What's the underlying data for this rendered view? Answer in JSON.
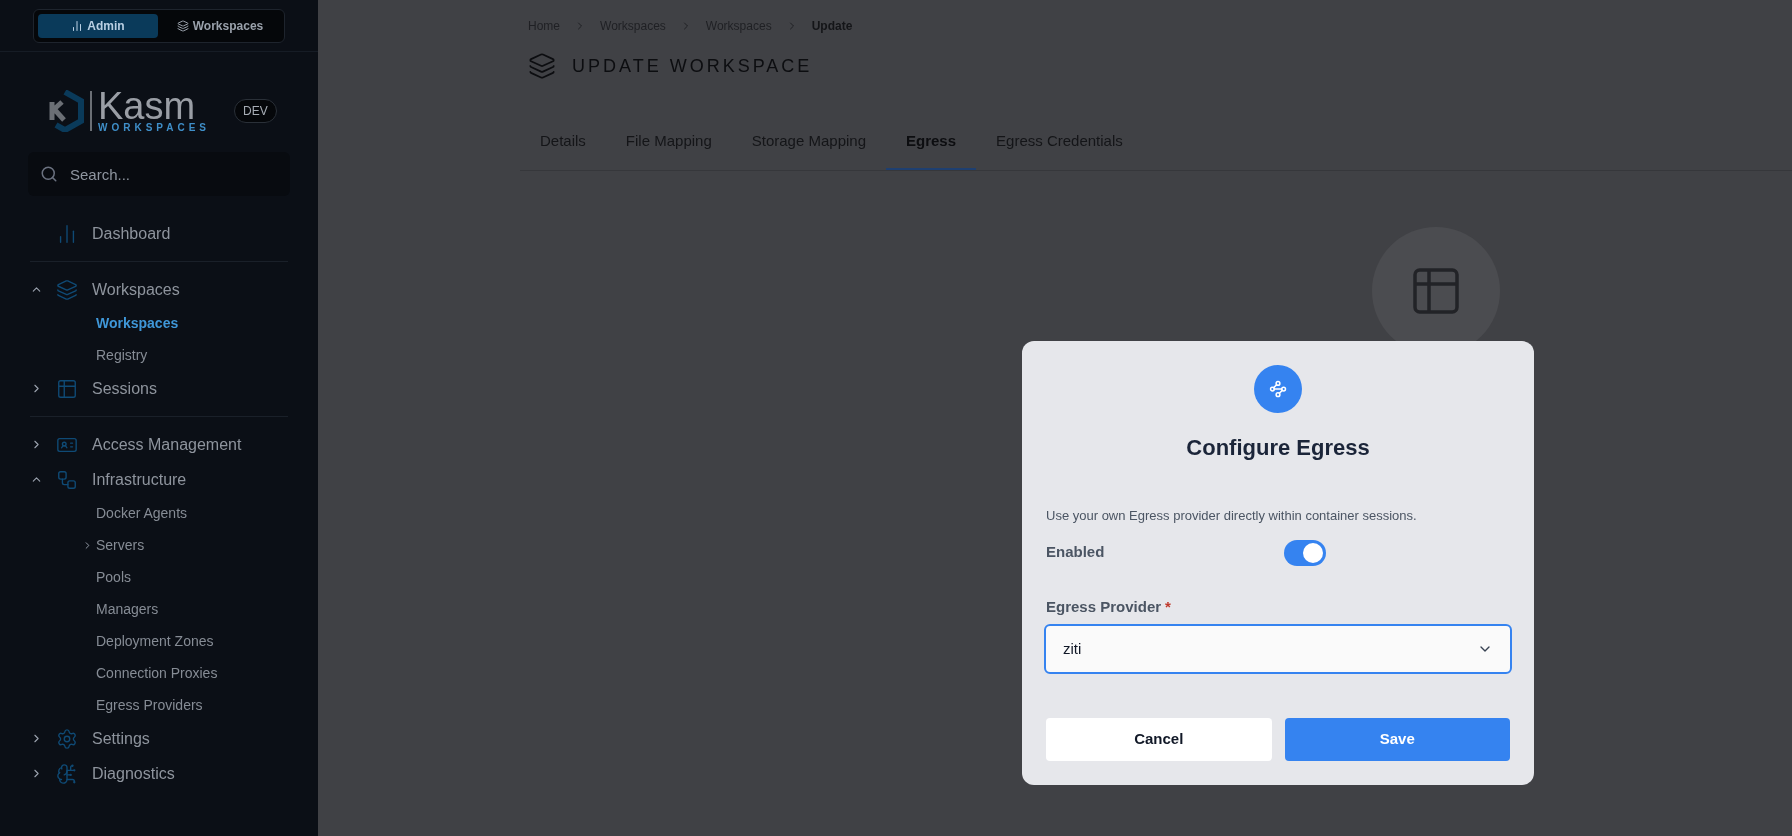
{
  "top_switch": [
    {
      "label": "Admin",
      "selected": true
    },
    {
      "label": "Workspaces",
      "selected": false
    }
  ],
  "logo": {
    "name": "Kasm",
    "tagline": "WORKSPACES"
  },
  "env_badge": "DEV",
  "search": {
    "placeholder": "Search..."
  },
  "nav": [
    {
      "label": "Dashboard"
    },
    {
      "label": "Workspaces",
      "expanded": true,
      "children": [
        {
          "label": "Workspaces",
          "selected": true
        },
        {
          "label": "Registry",
          "selected": false
        }
      ]
    },
    {
      "label": "Sessions",
      "expanded": false
    },
    {
      "label": "Access Management",
      "expanded": false
    },
    {
      "label": "Infrastructure",
      "expanded": true,
      "children": [
        {
          "label": "Docker Agents",
          "selected": false
        },
        {
          "label": "Servers",
          "selected": false,
          "expanded": false
        },
        {
          "label": "Pools",
          "selected": false
        },
        {
          "label": "Managers",
          "selected": false
        },
        {
          "label": "Deployment Zones",
          "selected": false
        },
        {
          "label": "Connection Proxies",
          "selected": false
        },
        {
          "label": "Egress Providers",
          "selected": false
        }
      ]
    },
    {
      "label": "Settings",
      "expanded": false
    },
    {
      "label": "Diagnostics",
      "expanded": false
    }
  ],
  "breadcrumbs": [
    "Home",
    "Workspaces",
    "Workspaces",
    "Update"
  ],
  "page_title": "UPDATE WORKSPACE",
  "tabs": [
    {
      "label": "Details",
      "selected": false
    },
    {
      "label": "File Mapping",
      "selected": false
    },
    {
      "label": "Storage Mapping",
      "selected": false
    },
    {
      "label": "Egress",
      "selected": true
    },
    {
      "label": "Egress Credentials",
      "selected": false
    }
  ],
  "modal": {
    "title": "Configure Egress",
    "description": "Use your own Egress provider directly within container sessions.",
    "enabled": {
      "label": "Enabled",
      "on": true
    },
    "provider": {
      "label": "Egress Provider",
      "required_mark": "*",
      "value": "ziti"
    },
    "cancel": "Cancel",
    "save": "Save"
  }
}
